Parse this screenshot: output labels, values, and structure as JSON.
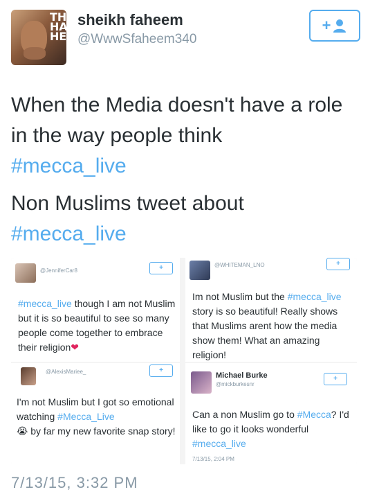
{
  "author": {
    "name": "sheikh faheem",
    "handle": "@WwwSfaheem340",
    "avatar_text": "TH\nHA\nHE"
  },
  "follow_button": {
    "label": "+"
  },
  "tweet": {
    "line1": "When the Media doesn't have a role in the way people think",
    "hashtag1": "#mecca_live",
    "line2": "Non Muslims tweet about",
    "hashtag2": "#mecca_live"
  },
  "embedded_tweets": [
    {
      "handle": "@JenniferCar8",
      "hashtag": "#mecca_live",
      "text": " though I am not Muslim but it is so beautiful to see so many people come together to embrace their religion",
      "emoji": "❤",
      "follow_label": "+"
    },
    {
      "handle": "@WHITEMAN_LNO",
      "text_a": "Im not Muslim but the ",
      "hashtag": "#mecca_live",
      "text_b": " story is so beautiful! Really shows that Muslims arent how the media show them! What an amazing religion!",
      "follow_label": "+"
    },
    {
      "handle": "@AlexisMariee_",
      "text_a": "I'm not Muslim but I got so emotional watching ",
      "hashtag": "#Mecca_Live",
      "emoji": "😭",
      "text_b": " by far my new favorite snap story!",
      "follow_label": "+"
    },
    {
      "name": "Michael Burke",
      "handle": "@mickburkesnr",
      "text_a": "Can a non Muslim go to ",
      "hashtag": "#Mecca",
      "text_b": "? I'd like to go it looks wonderful ",
      "hashtag2": "#mecca_live",
      "time": "7/13/15, 2:04 PM",
      "follow_label": "+"
    }
  ],
  "timestamp": "7/13/15, 3:32 PM",
  "colors": {
    "accent": "#55acee",
    "text": "#292f33",
    "muted": "#8899a6",
    "heart": "#e0245e"
  }
}
